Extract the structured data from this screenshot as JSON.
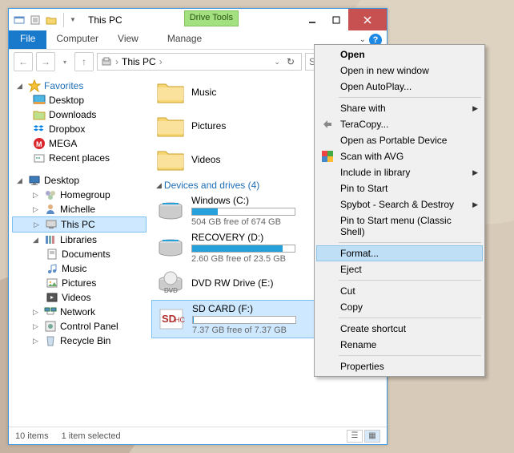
{
  "window": {
    "title": "This PC",
    "drive_tools_label": "Drive Tools"
  },
  "ribbon": {
    "file": "File",
    "tabs": [
      "Computer",
      "View",
      "Manage"
    ]
  },
  "address": {
    "path": "This PC",
    "search_placeholder": "Search This PC"
  },
  "nav": {
    "favorites": {
      "label": "Favorites",
      "items": [
        "Desktop",
        "Downloads",
        "Dropbox",
        "MEGA",
        "Recent places"
      ]
    },
    "desktop": {
      "label": "Desktop",
      "items": [
        {
          "label": "Homegroup"
        },
        {
          "label": "Michelle"
        },
        {
          "label": "This PC",
          "selected": true
        },
        {
          "label": "Libraries",
          "expanded": true,
          "children": [
            "Documents",
            "Music",
            "Pictures",
            "Videos"
          ]
        },
        {
          "label": "Network"
        },
        {
          "label": "Control Panel"
        },
        {
          "label": "Recycle Bin"
        }
      ]
    }
  },
  "content": {
    "folders": [
      "Music",
      "Pictures",
      "Videos"
    ],
    "devices_header": "Devices and drives (4)",
    "drives": [
      {
        "name": "Windows (C:)",
        "fill": 25,
        "sub": "504 GB free of 674 GB",
        "type": "hdd"
      },
      {
        "name": "RECOVERY (D:)",
        "fill": 88,
        "sub": "2.60 GB free of 23.5 GB",
        "type": "hdd"
      },
      {
        "name": "DVD RW Drive (E:)",
        "fill": null,
        "sub": "",
        "type": "dvd"
      },
      {
        "name": "SD CARD (F:)",
        "fill": 1,
        "sub": "7.37 GB free of 7.37 GB",
        "type": "sd",
        "selected": true
      }
    ]
  },
  "status": {
    "count": "10 items",
    "selection": "1 item selected"
  },
  "contextmenu": {
    "items": [
      {
        "label": "Open",
        "bold": true
      },
      {
        "label": "Open in new window"
      },
      {
        "label": "Open AutoPlay..."
      },
      {
        "sep": true
      },
      {
        "label": "Share with",
        "submenu": true
      },
      {
        "label": "TeraCopy...",
        "icon": "teracopy"
      },
      {
        "label": "Open as Portable Device"
      },
      {
        "label": "Scan with AVG",
        "icon": "avg"
      },
      {
        "label": "Include in library",
        "submenu": true
      },
      {
        "label": "Pin to Start"
      },
      {
        "label": "Spybot - Search & Destroy",
        "submenu": true
      },
      {
        "label": "Pin to Start menu (Classic Shell)"
      },
      {
        "sep": true
      },
      {
        "label": "Format...",
        "highlight": true
      },
      {
        "label": "Eject"
      },
      {
        "sep": true
      },
      {
        "label": "Cut"
      },
      {
        "label": "Copy"
      },
      {
        "sep": true
      },
      {
        "label": "Create shortcut"
      },
      {
        "label": "Rename"
      },
      {
        "sep": true
      },
      {
        "label": "Properties"
      }
    ]
  }
}
